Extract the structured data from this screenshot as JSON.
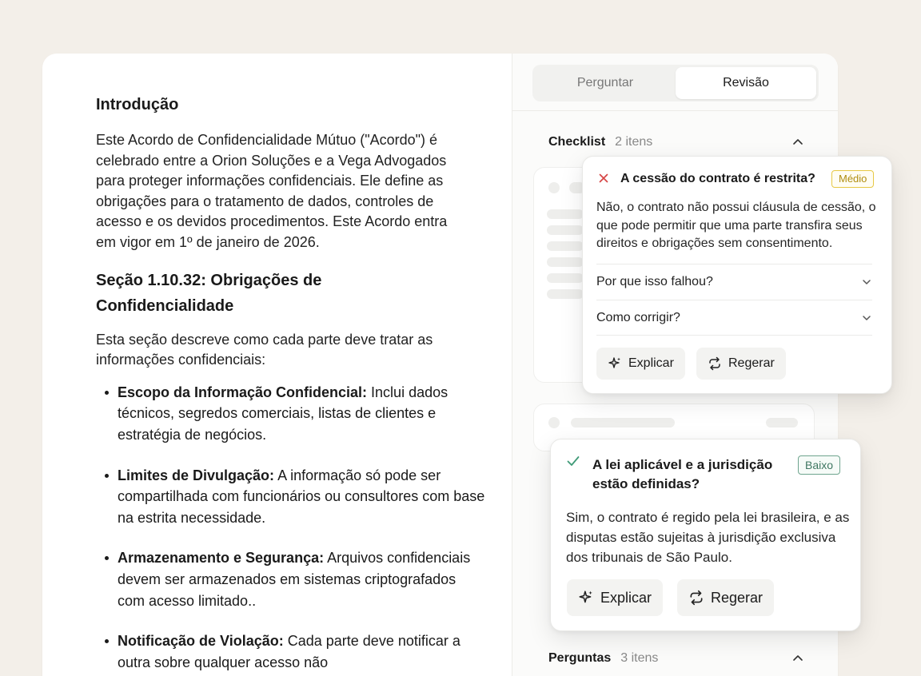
{
  "document": {
    "intro_heading": "Introdução",
    "intro_text": "Este Acordo de Confidencialidade Mútuo (\"Acordo\") é celebrado entre a Orion Soluções e a Vega Advogados para proteger informações confidenciais. Ele define as obrigações para o tratamento de dados, controles de acesso e os devidos procedimentos. Este Acordo entra em vigor em 1º de janeiro de 2026.",
    "section_heading": "Seção 1.10.32: Obrigações de Confidencialidade",
    "section_text": "Esta seção descreve como cada parte deve tratar as informações confidenciais:",
    "items": [
      {
        "term": "Escopo da Informação Confidencial:",
        "text": " Inclui dados técnicos, segredos comerciais, listas de clientes e estratégia de negócios."
      },
      {
        "term": "Limites de Divulgação:",
        "text": " A informação só pode ser compartilhada com funcionários ou consultores com base na estrita necessidade."
      },
      {
        "term": "Armazenamento e Segurança:",
        "text": " Arquivos confidenciais devem ser armazenados em sistemas criptografados com acesso limitado.."
      },
      {
        "term": "Notificação de Violação:",
        "text": " Cada parte deve notificar a outra sobre qualquer acesso não"
      }
    ]
  },
  "panel": {
    "tabs": [
      {
        "label": "Perguntar",
        "active": false
      },
      {
        "label": "Revisão",
        "active": true
      }
    ],
    "checklist": {
      "title": "Checklist",
      "count": "2 itens"
    },
    "questions": {
      "title": "Perguntas",
      "count": "3 itens"
    }
  },
  "popovers": [
    {
      "status": "fail",
      "question": "A cessão do contrato é restrita?",
      "badge": "Médio",
      "answer": "Não, o contrato não possui cláusula de cessão, o que pode permitir que uma parte transfira seus direitos e obrigações sem consentimento.",
      "accordions": [
        "Por que isso falhou?",
        "Como corrigir?"
      ],
      "explain_label": "Explicar",
      "regen_label": "Regerar"
    },
    {
      "status": "pass",
      "question": "A lei aplicável e a jurisdição estão definidas?",
      "badge": "Baixo",
      "answer": "Sim, o contrato é regido pela lei brasileira, e as disputas estão sujeitas à jurisdição exclusiva dos tribunais de São Paulo.",
      "explain_label": "Explicar",
      "regen_label": "Regerar"
    }
  ],
  "colors": {
    "background": "#f3efe9",
    "fail_red": "#d64545",
    "pass_green": "#3f9a77",
    "badge_medium": "#e7c845",
    "badge_low": "#6fa58f"
  },
  "icons": {
    "fail": "x-icon",
    "pass": "check-icon",
    "explain": "sparkle-icon",
    "regenerate": "repeat-icon",
    "collapse": "chevron-up-icon",
    "expand": "chevron-down-icon"
  }
}
